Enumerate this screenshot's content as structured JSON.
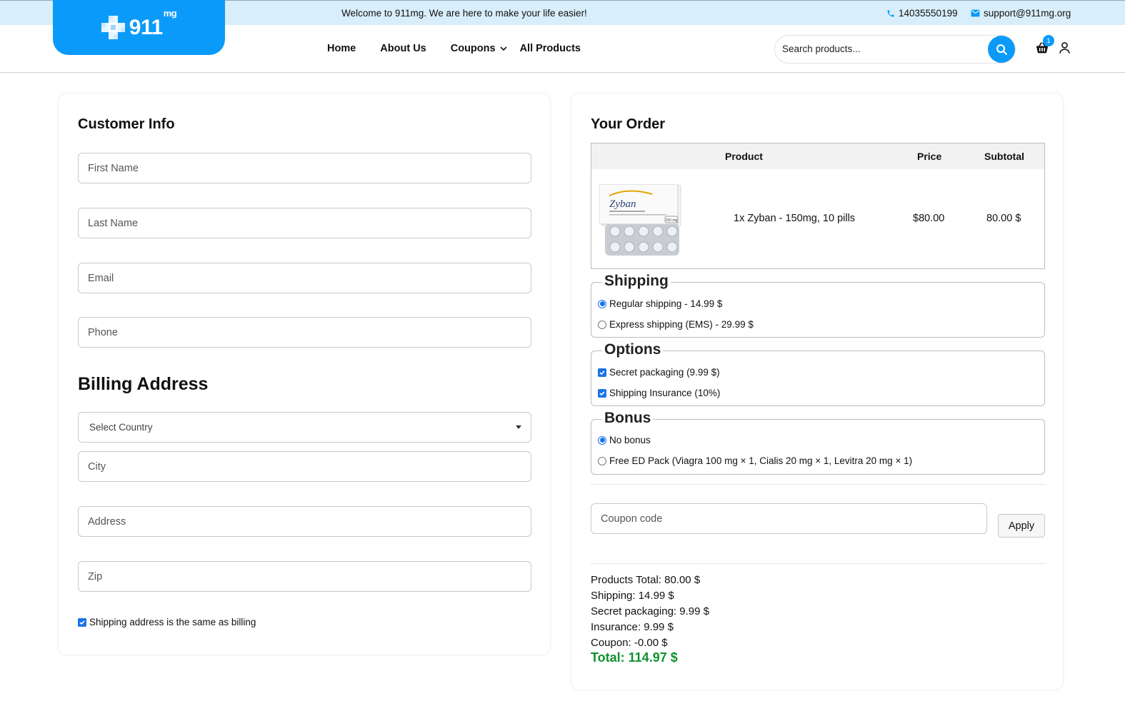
{
  "topbar": {
    "welcome": "Welcome to 911mg. We are here to make your life easier!",
    "phone": "14035550199",
    "email": "support@911mg.org"
  },
  "logo": {
    "text": "911",
    "superscript": "mg"
  },
  "nav": {
    "items": [
      {
        "label": "Home"
      },
      {
        "label": "About Us"
      },
      {
        "label": "Coupons"
      },
      {
        "label": "All Products"
      }
    ]
  },
  "search": {
    "placeholder": "Search products..."
  },
  "cart": {
    "count": "1"
  },
  "customer_info": {
    "title": "Customer Info",
    "first_name_placeholder": "First Name",
    "last_name_placeholder": "Last Name",
    "email_placeholder": "Email",
    "phone_placeholder": "Phone"
  },
  "billing": {
    "title": "Billing Address",
    "country_select": "Select Country",
    "city_placeholder": "City",
    "address_placeholder": "Address",
    "zip_placeholder": "Zip",
    "same_as_billing_label": "Shipping address is the same as billing"
  },
  "order": {
    "title": "Your Order",
    "columns": [
      "Product",
      "Price",
      "Subtotal"
    ],
    "items": [
      {
        "name": "1x Zyban - 150mg, 10 pills",
        "price": "$80.00",
        "subtotal": "80.00 $",
        "package_brand": "Zyban",
        "package_dose": "150 mg"
      }
    ]
  },
  "shipping": {
    "legend": "Shipping",
    "options": [
      {
        "label": "Regular shipping - 14.99 $",
        "selected": true
      },
      {
        "label": "Express shipping (EMS) - 29.99 $",
        "selected": false
      }
    ]
  },
  "options": {
    "legend": "Options",
    "items": [
      {
        "label": "Secret packaging (9.99 $)",
        "checked": true
      },
      {
        "label": "Shipping Insurance (10%)",
        "checked": true
      }
    ]
  },
  "bonus": {
    "legend": "Bonus",
    "options": [
      {
        "label": "No bonus",
        "selected": true
      },
      {
        "label": "Free ED Pack (Viagra 100 mg × 1, Cialis 20 mg × 1, Levitra 20 mg × 1)",
        "selected": false
      }
    ]
  },
  "coupon": {
    "placeholder": "Coupon code",
    "apply_label": "Apply"
  },
  "summary": {
    "products_total": "Products Total: 80.00 $",
    "shipping": "Shipping: 14.99 $",
    "secret_packaging": "Secret packaging: 9.99 $",
    "insurance": "Insurance: 9.99 $",
    "coupon": "Coupon: -0.00 $",
    "total": "Total: 114.97 $"
  },
  "colors": {
    "brand": "#0a9bfa",
    "topbar_bg": "#d9eefb",
    "total_green": "#10922e",
    "check_blue": "#1a73e8"
  }
}
